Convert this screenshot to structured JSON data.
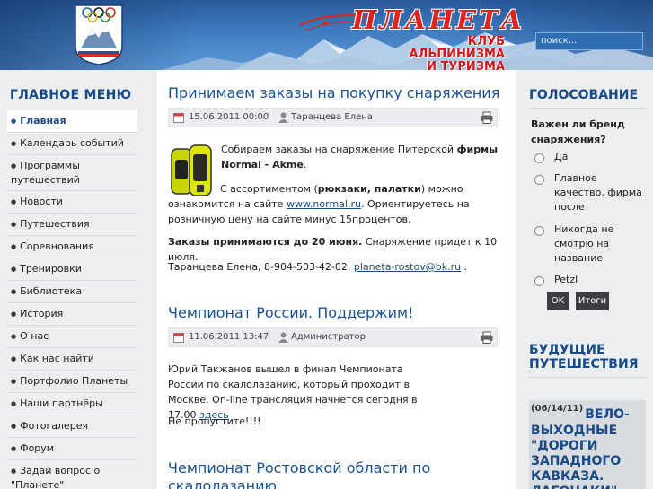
{
  "header": {
    "brand": "ПЛАНЕТА",
    "subtitle_lines": [
      "КЛУБ",
      "АЛЬПИНИЗМА",
      "И ТУРИЗМА"
    ],
    "logo_text": "КЛУБ ПЛАНЕТА",
    "search_placeholder": "поиск..."
  },
  "sidebar": {
    "title": "ГЛАВНОЕ МЕНЮ",
    "items": [
      {
        "label": "Главная",
        "active": true
      },
      {
        "label": "Календарь событий"
      },
      {
        "label": "Программы путешествий"
      },
      {
        "label": "Новости"
      },
      {
        "label": "Путешествия"
      },
      {
        "label": "Соревнования"
      },
      {
        "label": "Тренировки"
      },
      {
        "label": "Библиотека"
      },
      {
        "label": "История"
      },
      {
        "label": "О нас"
      },
      {
        "label": "Как нас найти"
      },
      {
        "label": "Портфолио Планеты"
      },
      {
        "label": "Наши партнёры"
      },
      {
        "label": "Фотогалерея"
      },
      {
        "label": "Форум"
      },
      {
        "label": "Задай вопрос о \"Планете\""
      }
    ]
  },
  "posts": [
    {
      "title": "Принимаем заказы на покупку снаряжения",
      "date": "15.06.2011 00:00",
      "author": "Таранцева Елена",
      "p1_a": "Собираем заказы на снаряжение Питерской ",
      "p1_b": "фирмы Normal - Akme",
      "p1_c": ".",
      "p2_a": "С ассортиментом (",
      "p2_b": "рюкзаки, палатки",
      "p2_c": ") можно ознакомится на сайте ",
      "p2_link": "www.normal.ru",
      "p2_d": ". Ориентируетесь на розничную цену на сайте минус 15процентов.",
      "p3_a": "Заказы принимаются до 20 июня.",
      "p3_b": " Снаряжение придет к 10 июля.",
      "p4_a": "Таранцева Елена, 8-904-503-42-02, ",
      "p4_link": "planeta-rostov@bk.ru",
      "p4_b": " ."
    },
    {
      "title": "Чемпионат России. Поддержим!",
      "date": "11.06.2011 13:47",
      "author": "Администратор",
      "p1_a": "Юрий Такжанов вышел в финал Чемпионата России по скалолазанию, который проходит в Москве. On-line трансляция начнется сегодня  в 17.00 ",
      "p1_link": "здесь",
      "p2": "Не пропустите!!!!"
    },
    {
      "title": "Чемпионат Ростовской области по скалолазанию"
    }
  ],
  "poll": {
    "title": "ГОЛОСОВАНИЕ",
    "question": "Важен ли бренд снаряжения?",
    "options": [
      "Да",
      "Главное качество, фирма после",
      "Никогда не смотрю на название",
      "Petzl"
    ],
    "ok_label": "OK",
    "results_label": "Итоги"
  },
  "trips": {
    "title": "БУДУЩИЕ ПУТЕШЕСТВИЯ",
    "date": "(06/14/11)",
    "headline": "ВЕЛО-ВЫХОДНЫЕ \"ДОРОГИ ЗАПАДНОГО КАВКАЗА. ЛАГОНАКИ\""
  },
  "colors": {
    "accent": "#1a5296",
    "brand_red": "#e2221c",
    "sidebar_bg": "#eceef0",
    "button_bg": "#3c3e42"
  }
}
